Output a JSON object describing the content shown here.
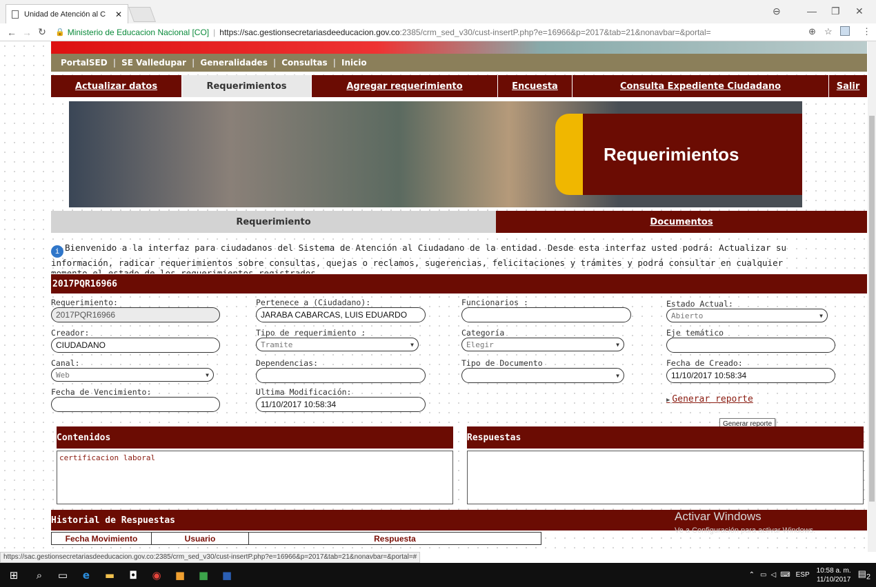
{
  "browser": {
    "tab_title": "Unidad de Atención al C",
    "site_identity": "Ministerio de Educacion Nacional [CO]",
    "url_host": "https://sac.gestionsecretariasdeeducacion.gov.co",
    "url_path": ":2385/crm_sed_v30/cust-insertP.php?e=16966&p=2017&tab=21&nonavbar=&portal=",
    "status_url": "https://sac.gestionsecretariasdeeducacion.gov.co:2385/crm_sed_v30/cust-insertP.php?e=16966&p=2017&tab=21&nonavbar=&portal=#"
  },
  "top_nav": [
    "PortalSED",
    "SE Valledupar",
    "Generalidades",
    "Consultas",
    "Inicio"
  ],
  "main_nav": [
    {
      "label": "Actualizar datos",
      "active": false
    },
    {
      "label": "Requerimientos",
      "active": true
    },
    {
      "label": "Agregar requerimiento",
      "active": false
    },
    {
      "label": "Encuesta",
      "active": false
    },
    {
      "label": "Consulta Expediente Ciudadano",
      "active": false
    },
    {
      "label": "Salir",
      "active": false
    }
  ],
  "hero_title": "Requerimientos",
  "sub_tabs": {
    "requerimiento": "Requerimiento",
    "documentos": "Documentos"
  },
  "info_text": "Bienvenido a la interfaz para ciudadanos del Sistema de Atención al Ciudadano de la entidad. Desde esta interfaz usted podrá: Actualizar su información, radicar requerimientos sobre consultas, quejas o reclamos, sugerencias, felicitaciones y trámites y podrá consultar en cualquier momento el estado de los requerimientos registrados.",
  "req_code": "2017PQR16966",
  "form": {
    "requerimiento": {
      "label": "Requerimiento:",
      "value": "2017PQR16966"
    },
    "pertenece": {
      "label": "Pertenece a (Ciudadano):",
      "value": "JARABA CABARCAS, LUIS EDUARDO"
    },
    "funcionarios": {
      "label": "Funcionarios :",
      "value": ""
    },
    "estado": {
      "label": "Estado Actual:",
      "value": "Abierto"
    },
    "creador": {
      "label": "Creador:",
      "value": "CIUDADANO"
    },
    "tipo_req": {
      "label": "Tipo de requerimiento :",
      "value": "Tramite"
    },
    "categoria": {
      "label": "Categoría",
      "value": "Elegir"
    },
    "eje": {
      "label": "Eje temático",
      "value": ""
    },
    "canal": {
      "label": "Canal:",
      "value": "Web"
    },
    "dependencias": {
      "label": "Dependencias:",
      "value": ""
    },
    "tipo_doc": {
      "label": "Tipo de Documento",
      "value": ""
    },
    "fecha_creado": {
      "label": "Fecha de Creado:",
      "value": "11/10/2017 10:58:34"
    },
    "fecha_venc": {
      "label": "Fecha de Vencimiento:",
      "value": ""
    },
    "ultima_mod": {
      "label": "Ultima Modificación:",
      "value": "11/10/2017 10:58:34"
    }
  },
  "generar_reporte": "Generar reporte",
  "tooltip": "Generar reporte",
  "contenidos": {
    "title": "Contenidos",
    "text": "certificacion laboral"
  },
  "respuestas": {
    "title": "Respuestas",
    "text": ""
  },
  "historial": {
    "title": "Historial de Respuestas",
    "columns": [
      "Fecha Movimiento",
      "Usuario",
      "Respuesta"
    ]
  },
  "activate": {
    "line1": "Activar Windows",
    "line2": "Ve a Configuración para activar Windows."
  },
  "tray": {
    "lang": "ESP",
    "time": "10:58 a. m.",
    "date": "11/10/2017",
    "notif": "2"
  }
}
